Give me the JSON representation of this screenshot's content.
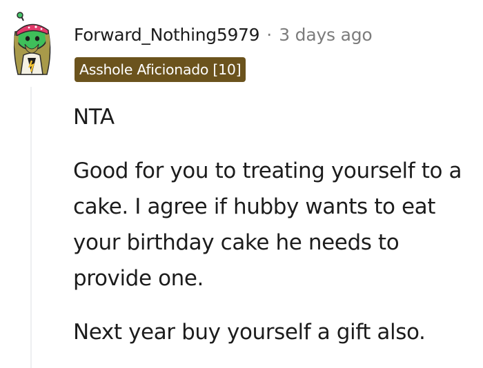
{
  "comment": {
    "author": "Forward_Nothing5979",
    "separator": "·",
    "timestamp": "3 days ago",
    "flair": "Asshole Aficionado [10]",
    "flair_color": "#6b531d",
    "avatar_icon": "snoo-avatar-icon",
    "paragraphs": [
      "NTA",
      "Good for you to treating yourself to a cake. I agree if hubby wants to eat your birthday cake he needs to provide one.",
      "Next year buy yourself a gift also."
    ]
  }
}
